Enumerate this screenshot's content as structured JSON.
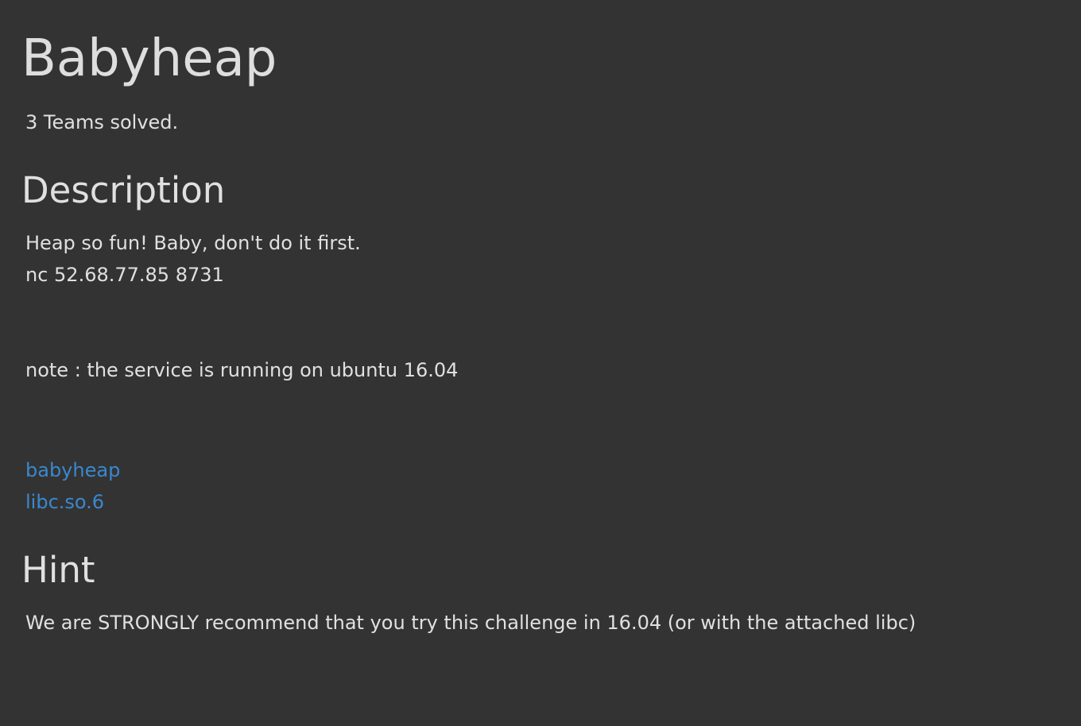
{
  "challenge": {
    "title": "Babyheap",
    "solved_text": "3 Teams solved."
  },
  "description": {
    "heading": "Description",
    "lines": [
      "Heap so fun! Baby, don't do it first.",
      "nc 52.68.77.85 8731",
      "note : the service is running on ubuntu 16.04"
    ],
    "files": [
      "babyheap",
      "libc.so.6"
    ]
  },
  "hint": {
    "heading": "Hint",
    "text": "We are STRONGLY recommend that you try this challenge in 16.04 (or with the attached libc)"
  },
  "colors": {
    "background": "#333333",
    "text": "#e0e0e0",
    "link": "#3a88cf"
  }
}
